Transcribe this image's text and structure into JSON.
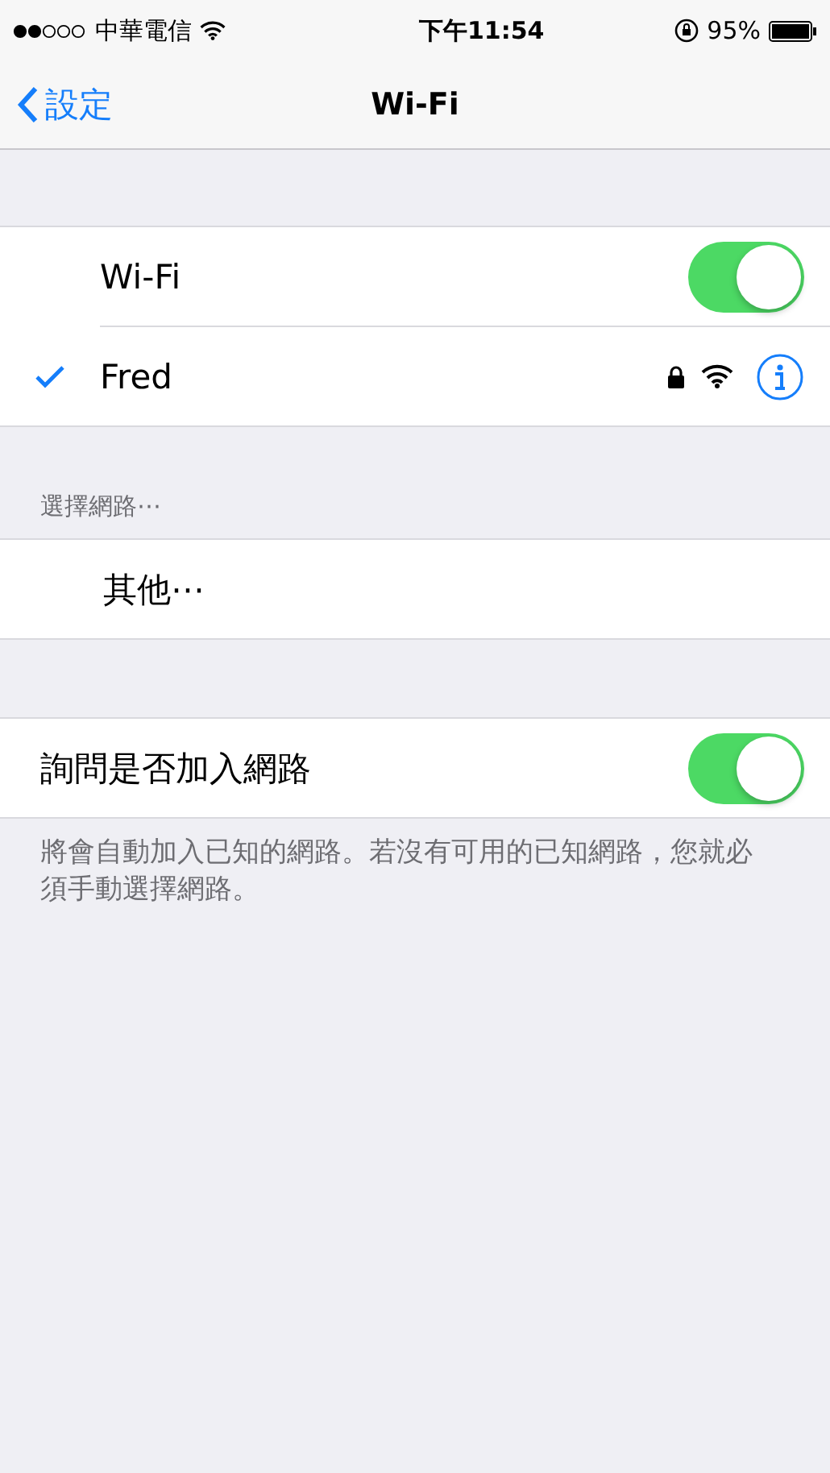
{
  "status_bar": {
    "carrier": "中華電信",
    "time": "下午11:54",
    "battery": "95%"
  },
  "nav": {
    "back": "設定",
    "title": "Wi-Fi"
  },
  "wifi_section": [
    {
      "kind": "toggle",
      "label": "Wi-Fi",
      "on": true
    },
    {
      "kind": "network",
      "label": "Fred",
      "checked": true,
      "locked": true
    }
  ],
  "choose_header": "選擇網路⋯",
  "other_row": {
    "label": "其他⋯"
  },
  "ask_row": {
    "label": "詢問是否加入網路",
    "on": true
  },
  "footer": "將會自動加入已知的網路。若沒有可用的已知網路，您就必須手動選擇網路。"
}
